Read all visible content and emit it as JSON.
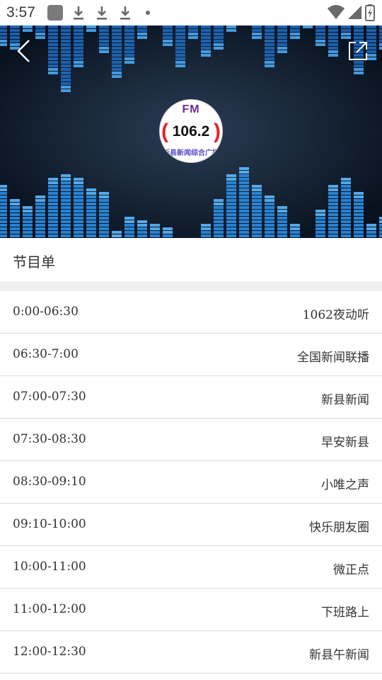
{
  "status_bar": {
    "time": "3:57",
    "icons": [
      "app-notification-icon",
      "download-icon",
      "download-icon",
      "download-icon",
      "more-notifications-dot-icon",
      "wifi-icon",
      "cell-signal-icon",
      "battery-charging-icon"
    ]
  },
  "header": {
    "back_icon": "chevron-left-icon",
    "share_icon": "share-icon"
  },
  "logo": {
    "fm_text": "FM",
    "frequency": "106.2",
    "subtitle": "新县新闻综合广播"
  },
  "section": {
    "title": "节目单"
  },
  "schedule": [
    {
      "time": "0:00-06:30",
      "program": "1062夜动听"
    },
    {
      "time": "06:30-7:00",
      "program": "全国新闻联播"
    },
    {
      "time": "07:00-07:30",
      "program": "新县新闻"
    },
    {
      "time": "07:30-08:30",
      "program": "早安新县"
    },
    {
      "time": "08:30-09:10",
      "program": "小唯之声"
    },
    {
      "time": "09:10-10:00",
      "program": "快乐朋友圈"
    },
    {
      "time": "10:00-11:00",
      "program": "微正点"
    },
    {
      "time": "11:00-12:00",
      "program": "下班路上"
    },
    {
      "time": "12:00-12:30",
      "program": "新县午新闻"
    }
  ],
  "colors": {
    "hero_background": "#0b1626",
    "equalizer_blue": "#2b8fe6",
    "logo_red": "#e3262a",
    "divider": "#dcdce0"
  }
}
